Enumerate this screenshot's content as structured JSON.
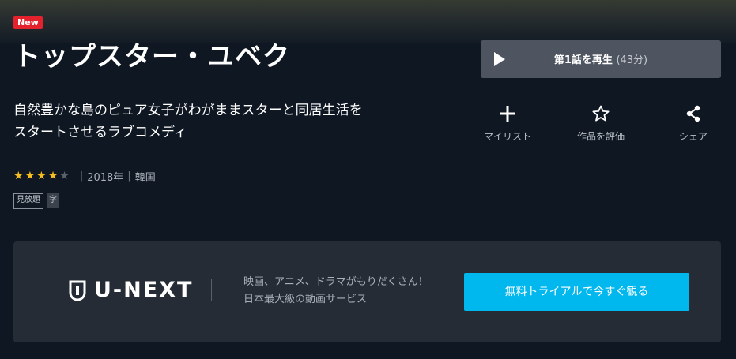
{
  "badge": {
    "label": "New"
  },
  "title": "トップスター・ユベク",
  "play": {
    "label": "第1話を再生",
    "duration": "(43分)"
  },
  "description": {
    "line1": "自然豊かな島のピュア女子がわがままスターと同居生活を",
    "line2": "スタートさせるラブコメディ"
  },
  "actions": {
    "mylist": {
      "label": "マイリスト",
      "icon": "plus-icon"
    },
    "rate": {
      "label": "作品を評価",
      "icon": "star-outline-icon"
    },
    "share": {
      "label": "シェア",
      "icon": "share-icon"
    }
  },
  "meta": {
    "rating": 4,
    "rating_max": 5,
    "separator": "|",
    "year": "2018年",
    "country": "韓国"
  },
  "tags": {
    "unlimited": "見放題",
    "subtitle": "字"
  },
  "promo": {
    "logo_text": "U-NEXT",
    "line1": "映画、アニメ、ドラマがもりだくさん！",
    "line2": "日本最大級の動画サービス",
    "cta_label": "無料トライアルで今すぐ観る"
  },
  "colors": {
    "background": "#0f1722",
    "new_badge": "#e3222d",
    "play_button": "#4e5560",
    "star_on": "#f5bd1f",
    "star_off": "#5a616b",
    "promo_panel": "#252c36",
    "cta_button": "#00b7ee"
  }
}
